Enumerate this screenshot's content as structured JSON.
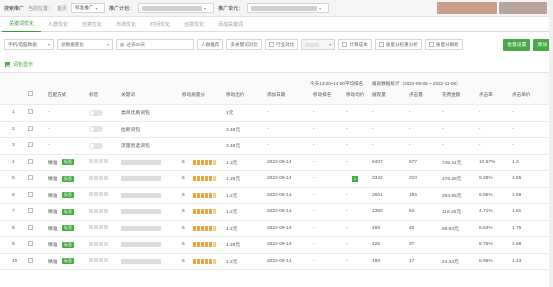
{
  "topbar": {
    "title": "搜索推广",
    "location_label": "当前位置：",
    "home_label": "首页",
    "standard_label": "标准推广",
    "plan_label": "推广计划：",
    "unit_label": "推广单元："
  },
  "tabs": [
    "关键词优化",
    "人群优化",
    "创意优化",
    "市场优化",
    "时间优化",
    "创意优化",
    "添加关键词"
  ],
  "toolbar": {
    "device_select": "手机/电脑数据",
    "metric_select": "总数据变化",
    "date_input": "过去30天",
    "crowd_btn": "人群推荐",
    "multi_btn": "多关键词对比",
    "industry_label": "行业对比",
    "compute_label": "计算成本",
    "quality_btn": "质量分权重分析",
    "qscore_btn": "质量分解析",
    "batch_btn": "批量设置",
    "add_btn": "添加"
  },
  "words_display_label": "词包显示",
  "table": {
    "header_group": "今天13:00~14:00平均排名",
    "report_label": "报表数据统计（2022-08-08 ~ 2022-11-06）",
    "columns": [
      "匹配方式",
      "标签",
      "关键词",
      "移动质量分",
      "移动出价",
      "添加日期",
      "移动排名",
      "移动均价",
      "展现量",
      "点击量",
      "花费金额",
      "点击率",
      "点击单价"
    ],
    "rows": [
      {
        "num": "1",
        "match": "-",
        "toggle": true,
        "keyword": "类目优质词包",
        "bars": 0,
        "price": "1元",
        "date": "-",
        "rank": "-",
        "avg": "-",
        "impr": "-",
        "clicks": "-",
        "cost": "-",
        "ctr": "-",
        "cpc": "-"
      },
      {
        "num": "2",
        "match": "-",
        "toggle": true,
        "keyword": "拉新词包",
        "bars": 0,
        "price": "3.48元",
        "date": "-",
        "rank": "-",
        "avg": "-",
        "impr": "-",
        "clicks": "-",
        "cost": "-",
        "ctr": "-",
        "cpc": "-"
      },
      {
        "num": "3",
        "match": "-",
        "toggle": true,
        "keyword": "流量智选词包",
        "bars": 0,
        "price": "3.48元",
        "date": "-",
        "rank": "-",
        "avg": "-",
        "impr": "-",
        "clicks": "-",
        "cost": "-",
        "ctr": "-",
        "cpc": "-"
      },
      {
        "num": "4",
        "match": "精准",
        "tag": "标签",
        "keyword": "",
        "qs": "6",
        "bars": 5,
        "price": "1.3元",
        "date": "2022-09-14",
        "rank": "-",
        "avg": "-",
        "impr": "5407",
        "clicks": "577",
        "cost": "746.31元",
        "ctr": "10.67%",
        "cpc": "1.3"
      },
      {
        "num": "5",
        "match": "精准",
        "tag": "标签",
        "keyword": "",
        "qs": "6",
        "bars": 5,
        "price": "1.28元",
        "date": "2022-09-14",
        "rank": "-",
        "avg": "-",
        "impr": "3342",
        "clicks": "310",
        "cost": "476.28元",
        "ctr": "9.28%",
        "cpc": "1.55",
        "badge": "1"
      },
      {
        "num": "6",
        "match": "精准",
        "tag": "标签",
        "keyword": "",
        "qs": "6",
        "bars": 5,
        "price": "1.2元",
        "date": "2022-09-14",
        "rank": "-",
        "avg": "-",
        "impr": "2661",
        "clicks": "185",
        "cost": "293.55元",
        "ctr": "6.95%",
        "cpc": "1.59"
      },
      {
        "num": "7",
        "match": "精准",
        "tag": "标签",
        "keyword": "",
        "qs": "6",
        "bars": 5,
        "price": "1.2元",
        "date": "2022-09-14",
        "rank": "-",
        "avg": "-",
        "impr": "1360",
        "clicks": "64",
        "cost": "116.25元",
        "ctr": "4.71%",
        "cpc": "1.81"
      },
      {
        "num": "8",
        "match": "精准",
        "tag": "标签",
        "keyword": "",
        "qs": "6",
        "bars": 5,
        "price": "1.2元",
        "date": "2022-09-14",
        "rank": "-",
        "avg": "-",
        "impr": "469",
        "clicks": "40",
        "cost": "69.93元",
        "ctr": "8.53%",
        "cpc": "1.75"
      },
      {
        "num": "9",
        "match": "精准",
        "tag": "标签",
        "keyword": "",
        "qs": "6",
        "bars": 5,
        "price": "1.28元",
        "date": "2022-09-14",
        "rank": "-",
        "avg": "-",
        "impr": "425",
        "clicks": "37",
        "cost": "",
        "ctr": "8.70%",
        "cpc": "1.58"
      },
      {
        "num": "10",
        "match": "精准",
        "tag": "标签",
        "keyword": "",
        "qs": "6",
        "bars": 5,
        "price": "1.2元",
        "date": "2022-09-14",
        "rank": "-",
        "avg": "-",
        "impr": "189",
        "clicks": "17",
        "cost": "24.33元",
        "ctr": "8.99%",
        "cpc": "1.43"
      }
    ]
  }
}
